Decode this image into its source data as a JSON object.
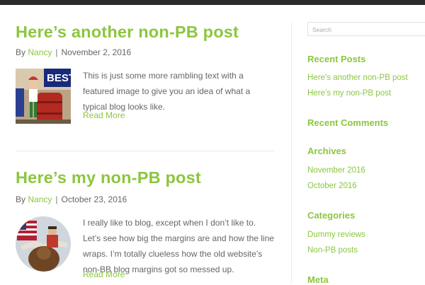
{
  "posts": [
    {
      "title": "Here’s another non-PB post",
      "by": "By",
      "author": "Nancy",
      "separator": "|",
      "date": "November 2, 2016",
      "excerpt": "This is just some more rambling text with a featured image to give you an idea of what a typical blog looks like.",
      "read_more": "Read More",
      "thumb_text": "BEST"
    },
    {
      "title": "Here’s my non-PB post",
      "by": "By",
      "author": "Nancy",
      "separator": "|",
      "date": "October 23, 2016",
      "excerpt": "I really like to blog, except when I don’t like to. Let’s see how big the margins are and how the line wraps. I’m totally clueless how the old website’s non-BB blog margins got so messed up.",
      "read_more": "Read More"
    }
  ],
  "sidebar": {
    "search_placeholder": "Search",
    "recent_posts_title": "Recent Posts",
    "recent_posts": [
      "Here’s another non-PB post",
      "Here’s my non-PB post"
    ],
    "recent_comments_title": "Recent Comments",
    "archives_title": "Archives",
    "archives": [
      "November 2016",
      "October 2016"
    ],
    "categories_title": "Categories",
    "categories": [
      "Dummy reviews",
      "Non-PB posts"
    ],
    "meta_title": "Meta"
  },
  "colors": {
    "accent": "#8cc63f",
    "text": "#666666",
    "topbar": "#2b2b2b"
  }
}
